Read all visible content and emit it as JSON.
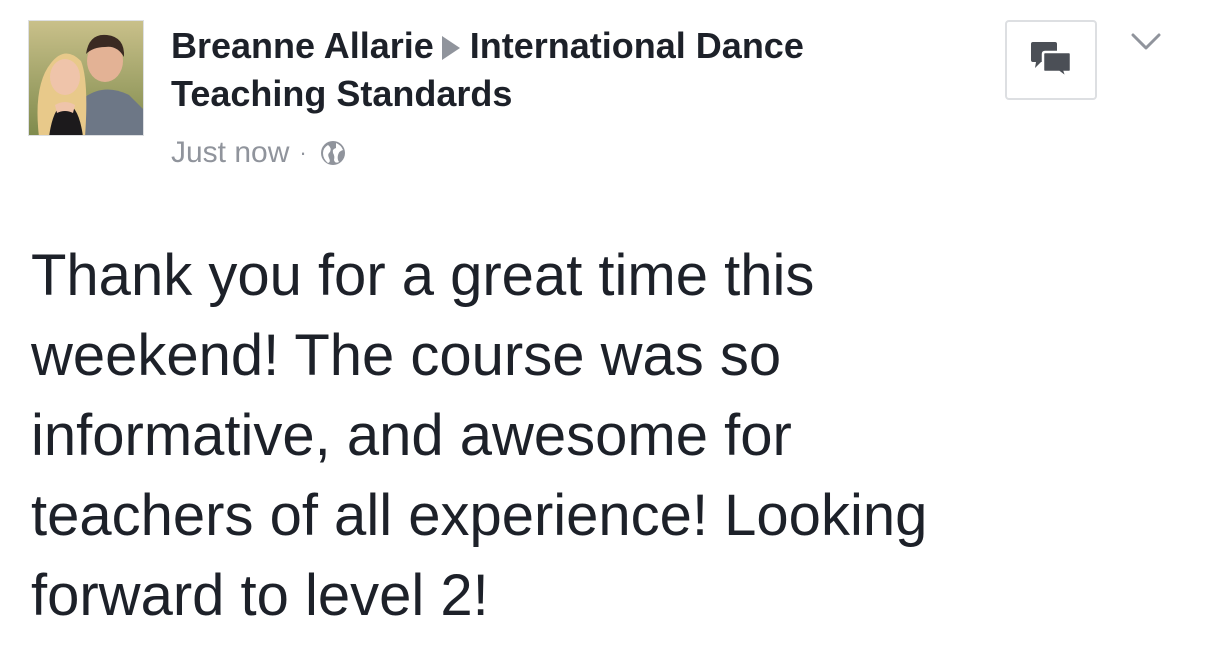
{
  "post": {
    "author": "Breanne Allarie",
    "target_line1": "International Dance",
    "target_line2": "Teaching Standards",
    "timestamp": "Just now",
    "separator": "·",
    "privacy_icon": "globe-icon",
    "message_lines": [
      "Thank you for a great time this",
      "weekend! The course was so",
      "informative, and awesome for",
      "teachers of all experience! Looking",
      "forward to level 2!"
    ]
  },
  "actions": {
    "message_icon": "chat-bubbles-icon",
    "menu_icon": "chevron-down-icon"
  },
  "colors": {
    "text_primary": "#1d2129",
    "text_secondary": "#90949c",
    "border": "#dddfe2"
  }
}
